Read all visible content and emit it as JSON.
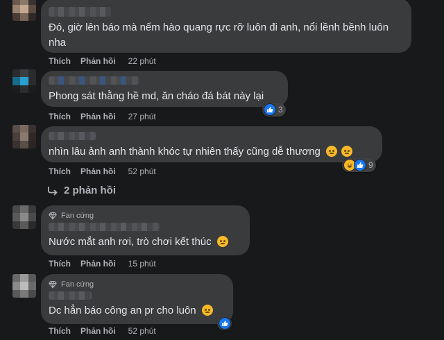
{
  "comments": [
    {
      "text": "Đó, giờ lên báo mà nếm hào quang rực rỡ luôn đi anh, nổi lềnh bềnh luôn nha",
      "like_label": "Thích",
      "reply_label": "Phản hồi",
      "time": "22 phút"
    },
    {
      "text": "Phong sát thằng hề md, ăn cháo đá bát này lại",
      "like_label": "Thích",
      "reply_label": "Phản hồi",
      "time": "27 phút",
      "reaction_count": "3"
    },
    {
      "text": "nhìn lâu ảnh anh thành khóc tự nhiên thấy cũng dễ thương",
      "like_label": "Thích",
      "reply_label": "Phản hồi",
      "time": "52 phút",
      "reaction_count": "9"
    },
    {
      "badge": "Fan cứng",
      "text": "Nước mắt anh rơi, trò chơi kết thúc",
      "like_label": "Thích",
      "reply_label": "Phản hồi",
      "time": "15 phút"
    },
    {
      "badge": "Fan cứng",
      "text": "Dc hẳn báo công an pr cho luôn",
      "like_label": "Thích",
      "reply_label": "Phản hồi",
      "time": "52 phút"
    }
  ],
  "replies_link": "2 phản hồi",
  "colors": {
    "like": "#1877f2",
    "haha": "#f7b928",
    "bubble": "#3a3b3c",
    "background": "#18191a"
  }
}
